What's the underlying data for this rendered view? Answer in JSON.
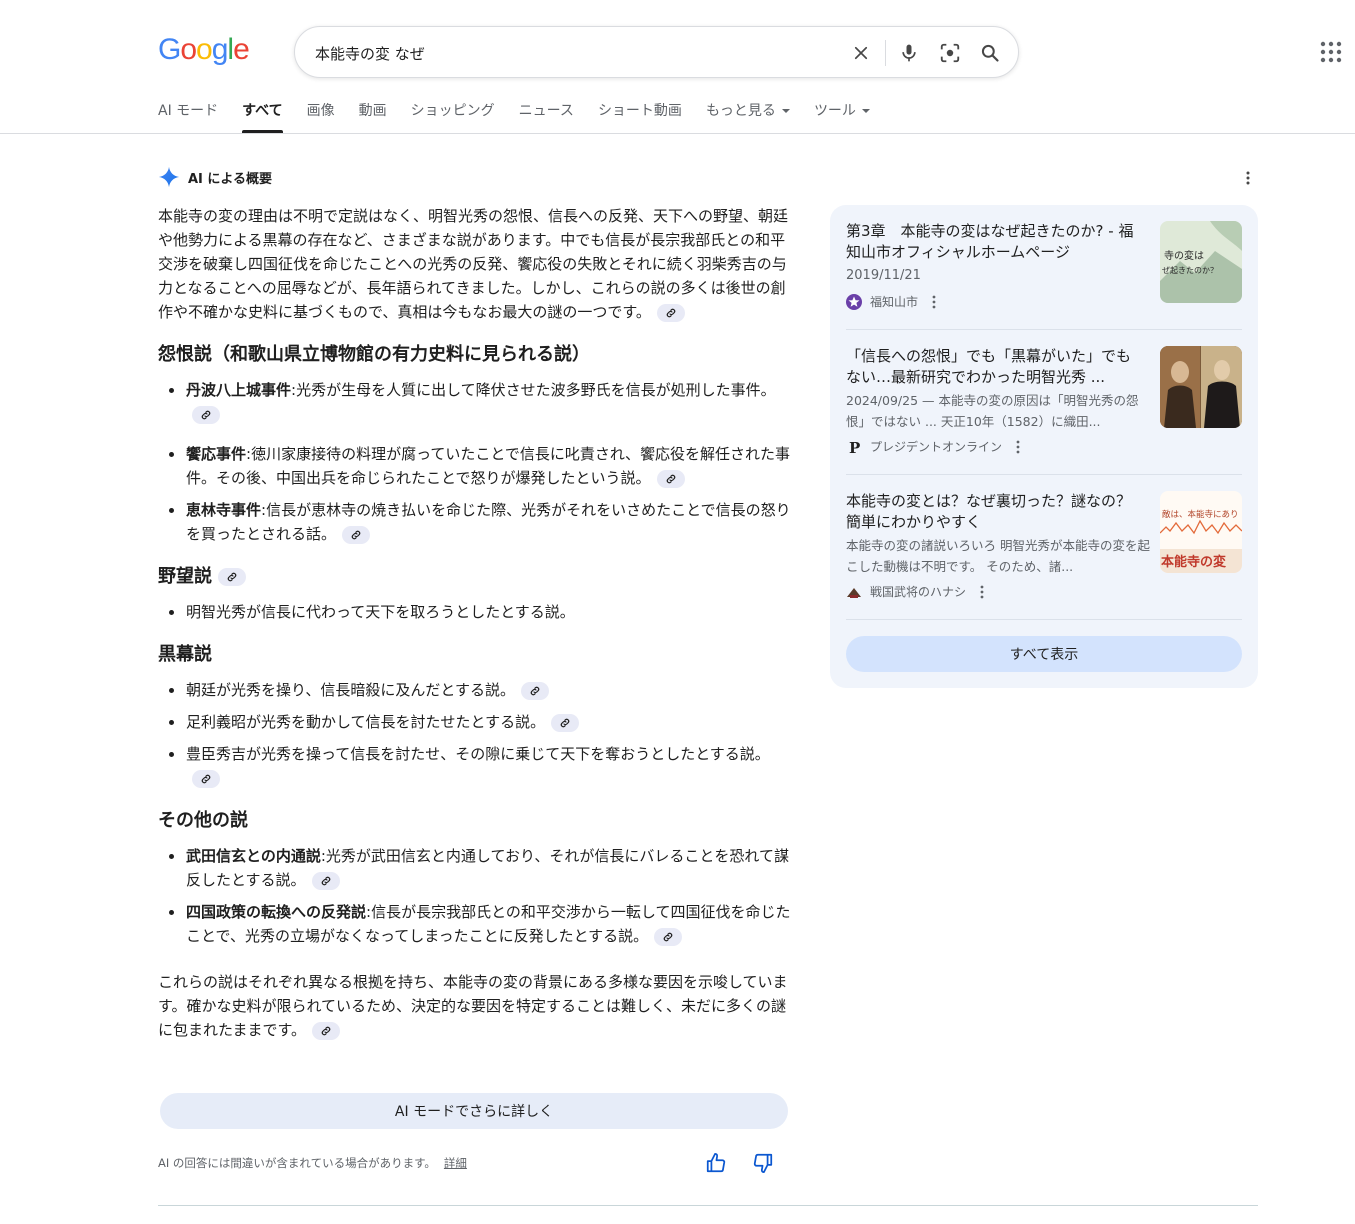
{
  "header": {
    "logo": "Google",
    "query": "本能寺の変 なぜ"
  },
  "tabs": [
    "AI モード",
    "すべて",
    "画像",
    "動画",
    "ショッピング",
    "ニュース",
    "ショート動画",
    "もっと見る",
    "ツール"
  ],
  "ai": {
    "title": "AI による概要",
    "intro": "本能寺の変の理由は不明で定説はなく、明智光秀の怨恨、信長への反発、天下への野望、朝廷や他勢力による黒幕の存在など、さまざまな説があります。中でも信長が長宗我部氏との和平交渉を破棄し四国征伐を命じたことへの光秀の反発、饗応役の失敗とそれに続く羽柴秀吉の与力となることへの屈辱などが、長年語られてきました。しかし、これらの説の多くは後世の創作や不確かな史料に基づくもので、真相は今もなお最大の謎の一つです。",
    "sections": [
      {
        "heading": "怨恨説（和歌山県立博物館の有力史料に見られる説）",
        "items": [
          {
            "bold": "丹波八上城事件",
            "text": ":光秀が生母を人質に出して降伏させた波多野氏を信長が処刑した事件。"
          },
          {
            "bold": "饗応事件",
            "text": ":徳川家康接待の料理が腐っていたことで信長に叱責され、饗応役を解任された事件。その後、中国出兵を命じられたことで怒りが爆発したという説。"
          },
          {
            "bold": "恵林寺事件",
            "text": ":信長が恵林寺の焼き払いを命じた際、光秀がそれをいさめたことで信長の怒りを買ったとされる話。"
          }
        ]
      },
      {
        "heading": "野望説",
        "items": [
          {
            "bold": "",
            "text": "明智光秀が信長に代わって天下を取ろうとしたとする説。"
          }
        ]
      },
      {
        "heading": "黒幕説",
        "items": [
          {
            "bold": "",
            "text": "朝廷が光秀を操り、信長暗殺に及んだとする説。"
          },
          {
            "bold": "",
            "text": "足利義昭が光秀を動かして信長を討たせたとする説。"
          },
          {
            "bold": "",
            "text": "豊臣秀吉が光秀を操って信長を討たせ、その隙に乗じて天下を奪おうとしたとする説。"
          }
        ]
      },
      {
        "heading": "その他の説",
        "items": [
          {
            "bold": "武田信玄との内通説",
            "text": ":光秀が武田信玄と内通しており、それが信長にバレることを恐れて謀反したとする説。"
          },
          {
            "bold": "四国政策の転換への反発説",
            "text": ":信長が長宗我部氏との和平交渉から一転して四国征伐を命じたことで、光秀の立場がなくなってしまったことに反発したとする説。"
          }
        ]
      }
    ],
    "conclusion": "これらの説はそれぞれ異なる根拠を持ち、本能寺の変の背景にある多様な要因を示唆しています。確かな史料が限られているため、決定的な要因を特定することは難しく、未だに多くの謎に包まれたままです。",
    "ai_mode_button": "AI モードでさらに詳しく",
    "disclaimer": "AI の回答には間違いが含まれている場合があります。",
    "details_link": "詳細"
  },
  "sources": [
    {
      "title": "第3章　本能寺の変はなぜ起きたのか? - 福知山市オフィシャルホームページ",
      "meta": "2019/11/21",
      "site": "福知山市",
      "image_text": [
        "寺の変は",
        "ぜ起きたのか？"
      ]
    },
    {
      "title": "「信長への怨恨」でも「黒幕がいた」でもない…最新研究でわかった明智光秀 ...",
      "meta": "2024/09/25 — 本能寺の変の原因は「明智光秀の怨恨」ではない ... 天正10年（1582）に織田...",
      "site": "プレジデントオンライン",
      "image_text": []
    },
    {
      "title": "本能寺の変とは？なぜ裏切った？謎なの？簡単にわかりやすく",
      "meta": "本能寺の変の諸説いろいろ 明智光秀が本能寺の変を起こした動機は不明です。 そのため、諸...",
      "site": "戦国武将のハナシ",
      "image_text": [
        "敵は、本能寺にあり",
        "本能寺の変"
      ]
    }
  ],
  "show_all": "すべて表示",
  "colors": {
    "logo_blue": "#4285F4",
    "logo_red": "#EA4335",
    "logo_yellow": "#FBBC05",
    "logo_green": "#34A853",
    "panel_bg": "#f0f4fb",
    "button_bg": "#d3e3fd"
  }
}
